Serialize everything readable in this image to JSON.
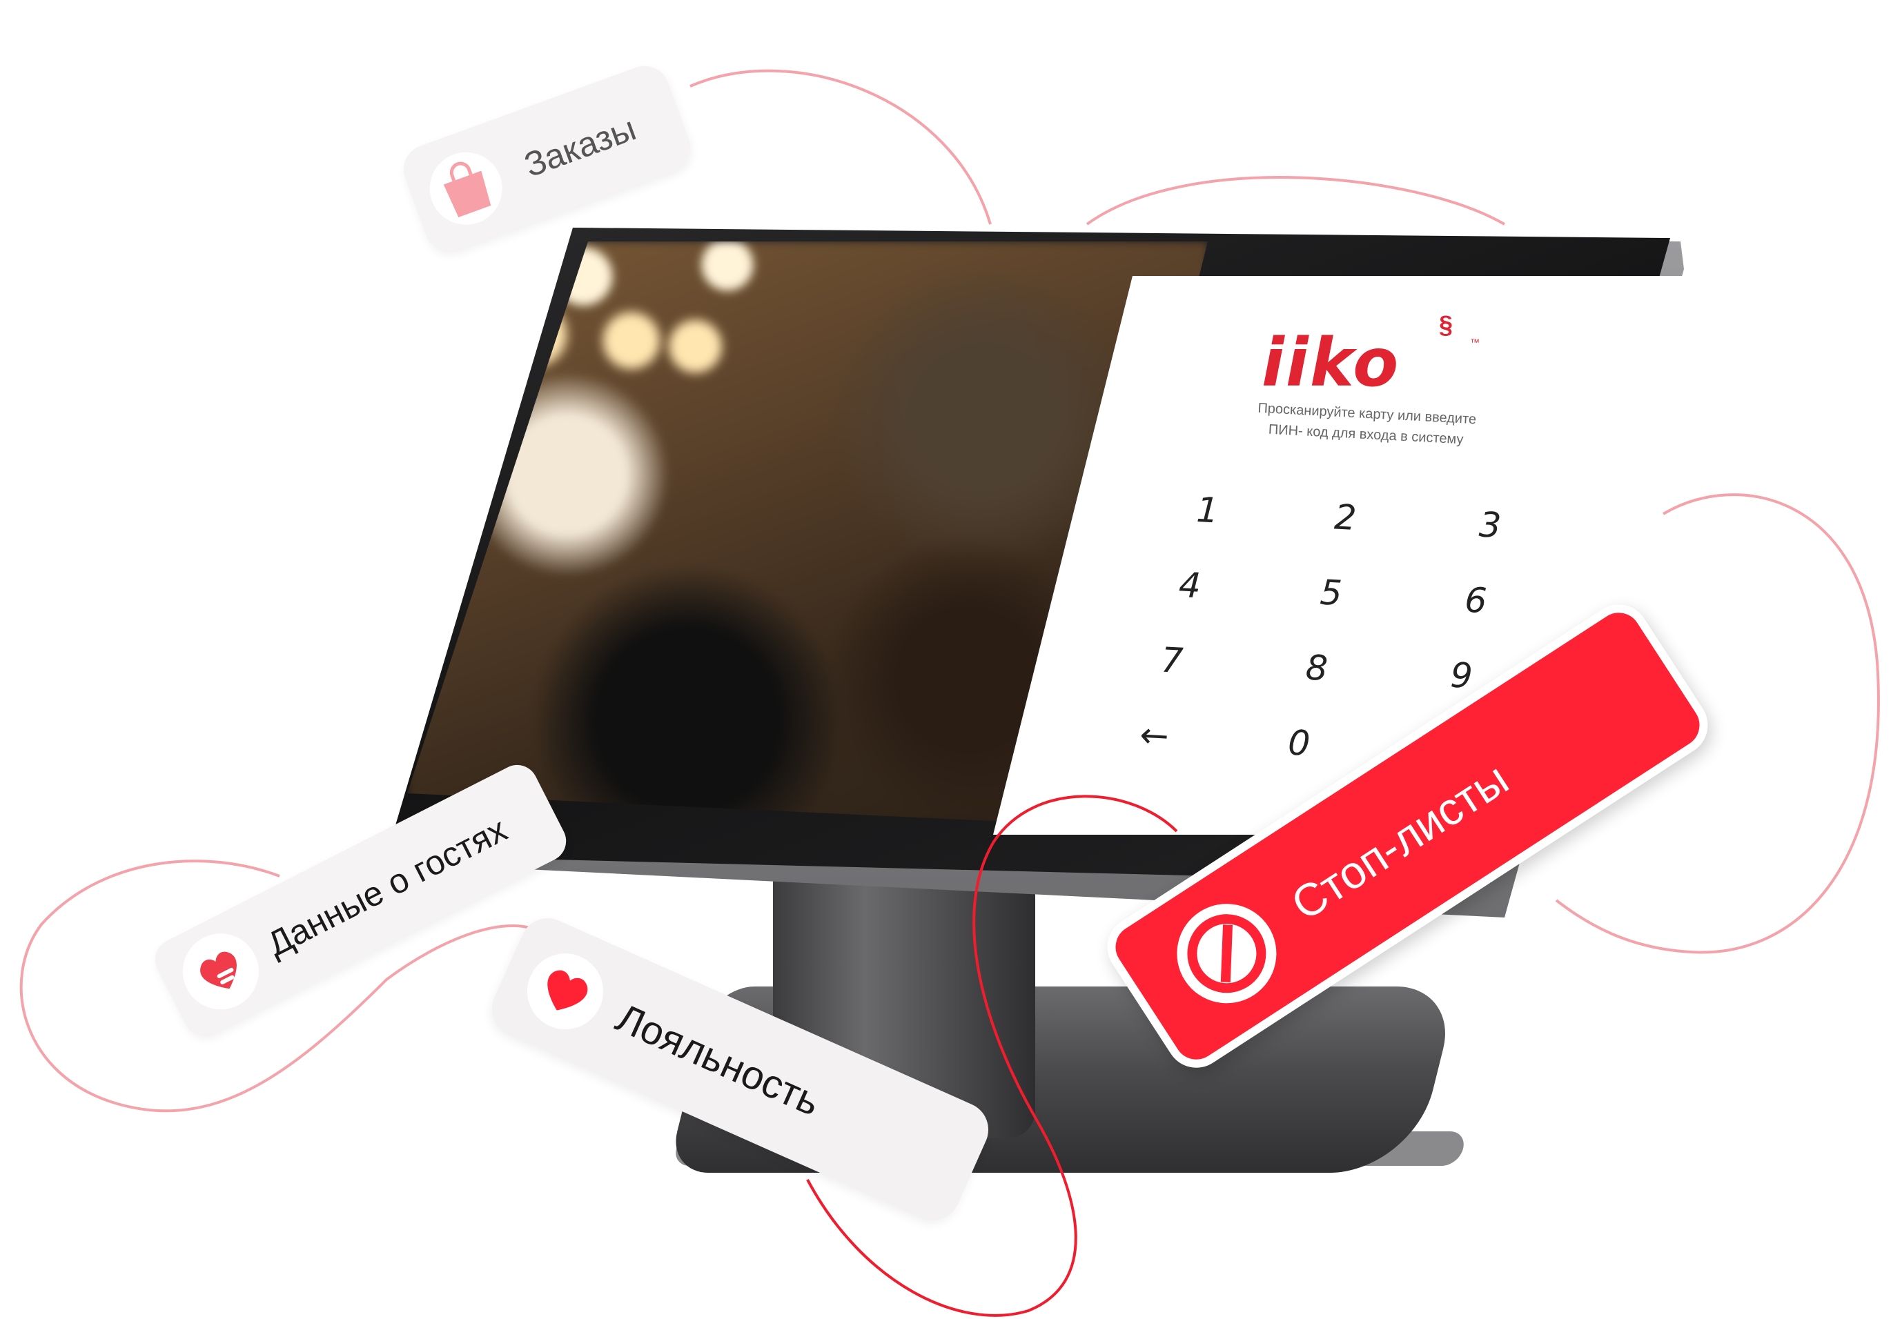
{
  "terminal": {
    "logo": "iiko",
    "logo_mark": "™",
    "prompt_line1": "Просканируйте карту или введите",
    "prompt_line2": "ПИН- код для входа в систему",
    "keys": [
      "1",
      "2",
      "3",
      "4",
      "5",
      "6",
      "7",
      "8",
      "9",
      "←",
      "0"
    ]
  },
  "cards": {
    "orders": {
      "label": "Заказы",
      "icon": "shopping-bag-icon"
    },
    "guests": {
      "label": "Данные о гостях",
      "icon": "heart-hand-icon"
    },
    "loyalty": {
      "label": "Лояльность",
      "icon": "heart-icon"
    },
    "stoplists": {
      "label": "Стоп-листы",
      "icon": "prohibition-icon"
    }
  },
  "colors": {
    "brand_red": "#e02431",
    "stop_card_red": "#ff2235",
    "pink_curve": "#f4a3aa",
    "card_bg": "#f5f3f3"
  }
}
